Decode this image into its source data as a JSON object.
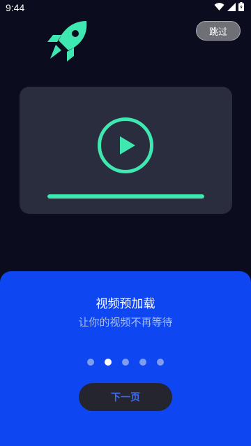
{
  "status_bar": {
    "time": "9:44",
    "icons": [
      "wifi-icon",
      "signal-icon",
      "battery-icon"
    ]
  },
  "header": {
    "skip_label": "跳过"
  },
  "illustration": {
    "icon": "rocket-icon",
    "video_icon": "play-icon",
    "progress_fraction": 1.0
  },
  "panel": {
    "title": "视频预加载",
    "subtitle": "让你的视频不再等待",
    "page_count": 5,
    "active_page": 2,
    "next_label": "下一页"
  },
  "colors": {
    "background": "#0b0d1e",
    "accent": "#3fe8b0",
    "card": "#2a2d3e",
    "panel": "#0e47f2",
    "button": "#24252e",
    "button_text": "#3e6cf5"
  }
}
